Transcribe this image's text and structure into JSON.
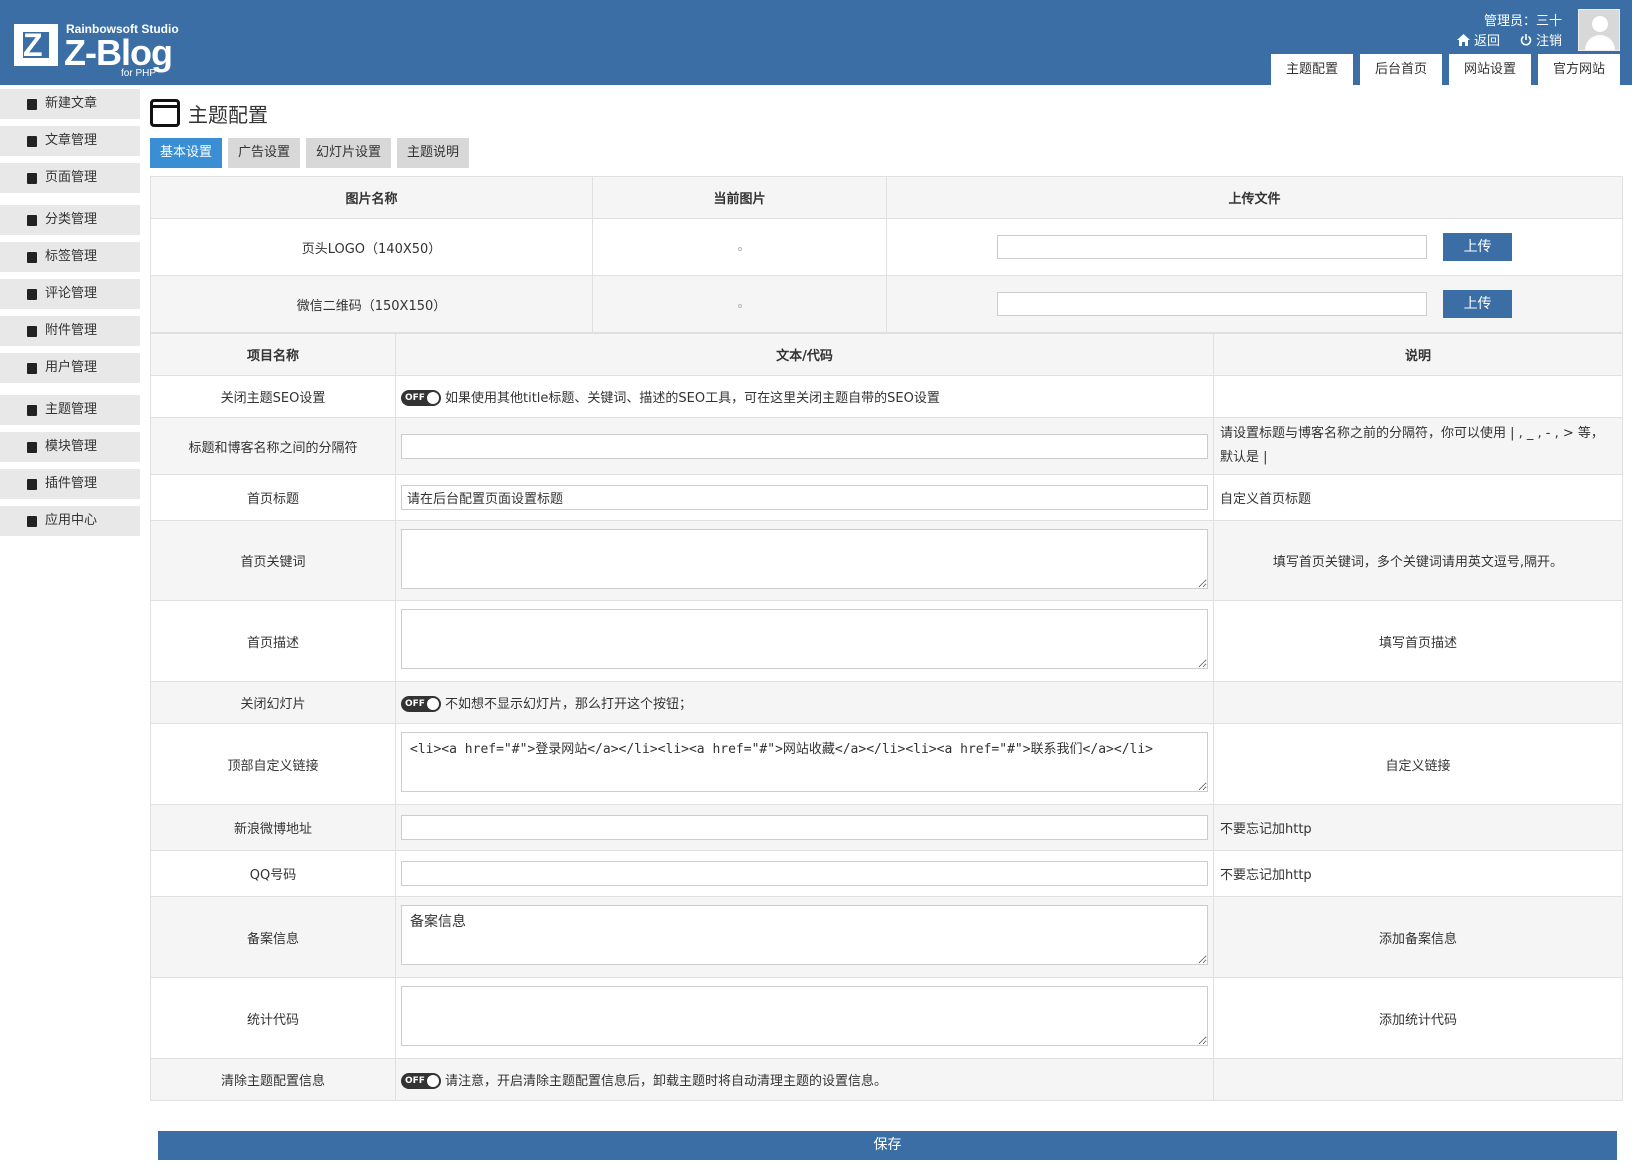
{
  "header": {
    "logo": {
      "studio": "Rainbowsoft Studio",
      "title": "Z-Blog",
      "sub": "for PHP"
    },
    "user_label": "管理员：三十",
    "back_label": "返回",
    "logout_label": "注销",
    "tabs": [
      "主题配置",
      "后台首页",
      "网站设置",
      "官方网站"
    ]
  },
  "sidebar": {
    "items": [
      {
        "label": "新建文章",
        "icon": "edit-icon"
      },
      {
        "label": "文章管理",
        "icon": "articles-icon"
      },
      {
        "label": "页面管理",
        "icon": "pages-icon"
      },
      {
        "label": "分类管理",
        "icon": "folder-icon"
      },
      {
        "label": "标签管理",
        "icon": "tag-icon"
      },
      {
        "label": "评论管理",
        "icon": "comment-icon"
      },
      {
        "label": "附件管理",
        "icon": "attachment-icon"
      },
      {
        "label": "用户管理",
        "icon": "user-icon"
      },
      {
        "label": "主题管理",
        "icon": "theme-icon"
      },
      {
        "label": "模块管理",
        "icon": "module-icon"
      },
      {
        "label": "插件管理",
        "icon": "plugin-icon"
      },
      {
        "label": "应用中心",
        "icon": "app-center-icon"
      }
    ]
  },
  "main": {
    "title": "主题配置",
    "tabs": [
      "基本设置",
      "广告设置",
      "幻灯片设置",
      "主题说明"
    ],
    "image_table": {
      "headers": [
        "图片名称",
        "当前图片",
        "上传文件"
      ],
      "rows": [
        {
          "name": "页头LOGO（140X50）",
          "button": "上传"
        },
        {
          "name": "微信二维码（150X150）",
          "button": "上传"
        }
      ]
    },
    "settings_table": {
      "headers": [
        "项目名称",
        "文本/代码",
        "说明"
      ],
      "toggle_label": "OFF",
      "rows": [
        {
          "name": "关闭主题SEO设置",
          "text": "如果使用其他title标题、关键词、描述的SEO工具，可在这里关闭主题自带的SEO设置",
          "desc": ""
        },
        {
          "name": "标题和博客名称之间的分隔符",
          "value": "",
          "desc": "请设置标题与博客名称之前的分隔符，你可以使用 | , _ , - , > 等，默认是 |"
        },
        {
          "name": "首页标题",
          "value": "请在后台配置页面设置标题",
          "desc": "自定义首页标题"
        },
        {
          "name": "首页关键词",
          "value": "",
          "desc": "填写首页关键词，多个关键词请用英文逗号,隔开。"
        },
        {
          "name": "首页描述",
          "value": "",
          "desc": "填写首页描述"
        },
        {
          "name": "关闭幻灯片",
          "text": "不如想不显示幻灯片，那么打开这个按钮；",
          "desc": ""
        },
        {
          "name": "顶部自定义链接",
          "value": "<li><a href=\"#\">登录网站</a></li><li><a href=\"#\">网站收藏</a></li><li><a href=\"#\">联系我们</a></li>",
          "desc": "自定义链接"
        },
        {
          "name": "新浪微博地址",
          "value": "",
          "desc": "不要忘记加http"
        },
        {
          "name": "QQ号码",
          "value": "",
          "desc": "不要忘记加http"
        },
        {
          "name": "备案信息",
          "value": "备案信息",
          "desc": "添加备案信息"
        },
        {
          "name": "统计代码",
          "value": "",
          "desc": "添加统计代码"
        },
        {
          "name": "清除主题配置信息",
          "text": "请注意，开启清除主题配置信息后，卸载主题时将自动清理主题的设置信息。",
          "desc": ""
        }
      ]
    },
    "save_label": "保存"
  }
}
